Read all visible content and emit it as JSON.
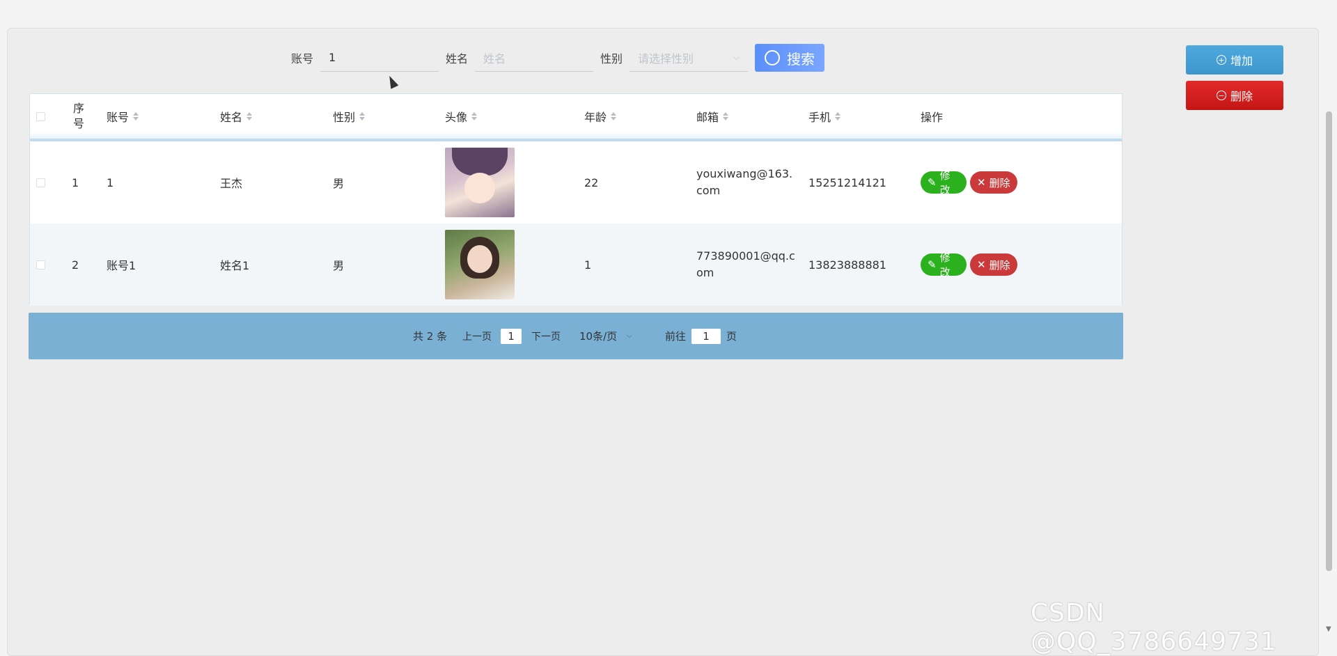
{
  "search": {
    "account_label": "账号",
    "account_value": "1",
    "name_label": "姓名",
    "name_placeholder": "姓名",
    "gender_label": "性别",
    "gender_placeholder": "请选择性别",
    "search_button": "搜索"
  },
  "actions": {
    "add_label": "增加",
    "delete_label": "删除"
  },
  "table": {
    "headers": {
      "index": "序号",
      "account": "账号",
      "name": "姓名",
      "gender": "性别",
      "avatar": "头像",
      "age": "年龄",
      "email": "邮箱",
      "phone": "手机",
      "ops": "操作"
    },
    "rows": [
      {
        "index": "1",
        "account": "1",
        "name": "王杰",
        "gender": "男",
        "age": "22",
        "email": "youxiwang@163.com",
        "phone": "15251214121"
      },
      {
        "index": "2",
        "account": "账号1",
        "name": "姓名1",
        "gender": "男",
        "age": "1",
        "email": "773890001@qq.com",
        "phone": "13823888881"
      }
    ],
    "edit_label": "修改",
    "delete_label": "删除"
  },
  "pagination": {
    "total": "共 2 条",
    "prev": "上一页",
    "current": "1",
    "next": "下一页",
    "page_size": "10条/页",
    "goto_label": "前往",
    "goto_value": "1",
    "page_suffix": "页"
  },
  "watermark": "CSDN @QQ_3786649731"
}
